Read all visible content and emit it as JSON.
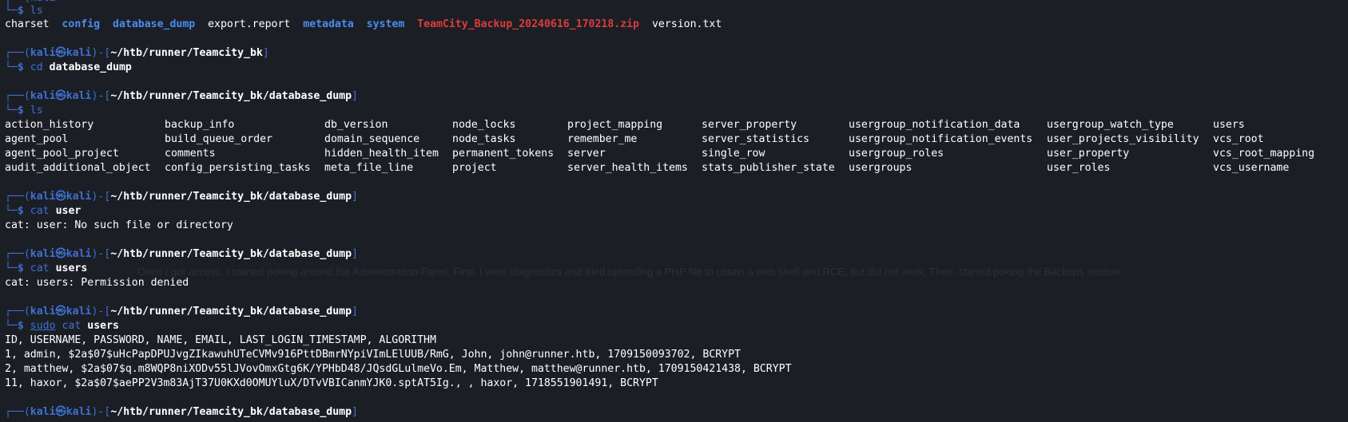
{
  "prompt": {
    "user": "kali",
    "at": "㉿",
    "host": "kali",
    "top": "┌──(",
    "close": ")-[",
    "end": "]",
    "bottom": "└─",
    "dollar": "$"
  },
  "paths": {
    "bk": "~/htb/runner/Teamcity_bk",
    "dump": "~/htb/runner/Teamcity_bk/database_dump"
  },
  "cmds": {
    "ls": "ls",
    "cd": "cd",
    "cd_arg": "database_dump",
    "cat": "cat",
    "sudo": "sudo",
    "arg_user": "user",
    "arg_users": "users"
  },
  "ls1": {
    "charset": "charset",
    "config": "config",
    "database_dump": "database_dump",
    "export_report": "export.report",
    "metadata": "metadata",
    "system": "system",
    "zip": "TeamCity_Backup_20240616_170218.zip",
    "version": "version.txt"
  },
  "ls2": [
    [
      "action_history",
      "agent_pool",
      "agent_pool_project",
      "audit_additional_object"
    ],
    [
      "backup_info",
      "build_queue_order",
      "comments",
      "config_persisting_tasks"
    ],
    [
      "db_version",
      "domain_sequence",
      "hidden_health_item",
      "meta_file_line"
    ],
    [
      "node_locks",
      "node_tasks",
      "permanent_tokens",
      "project"
    ],
    [
      "project_mapping",
      "remember_me",
      "server",
      "server_health_items"
    ],
    [
      "server_property",
      "server_statistics",
      "single_row",
      "stats_publisher_state"
    ],
    [
      "usergroup_notification_data",
      "usergroup_notification_events",
      "usergroup_roles",
      "usergroups"
    ],
    [
      "usergroup_watch_type",
      "user_projects_visibility",
      "user_property",
      "user_roles"
    ],
    [
      "users",
      "vcs_root",
      "vcs_root_mapping",
      "vcs_username"
    ]
  ],
  "errors": {
    "user": "cat: user: No such file or directory",
    "users": "cat: users: Permission denied"
  },
  "users_table": [
    "ID, USERNAME, PASSWORD, NAME, EMAIL, LAST_LOGIN_TIMESTAMP, ALGORITHM",
    "1, admin, $2a$07$uHcPapDPUJvgZIkawuhUTeCVMv916PttDBmrNYpiVImLElUUB/RmG, John, john@runner.htb, 1709150093702, BCRYPT",
    "2, matthew, $2a$07$q.m8WQP8niXODv55lJVovOmxGtg6K/YPHbD48/JQsdGLulmeVo.Em, Matthew, matthew@runner.htb, 1709150421438, BCRYPT",
    "11, haxor, $2a$07$aePP2V3m83AjT37U0KXd0OMUYluX/DTvVBICanmYJK0.sptAT5Ig., , haxor, 1718551901491, BCRYPT"
  ],
  "ghost_text": "Once I got access, I started poking around the Administration Panel. First, I went diagnostics and tried uploading a PHP file to obtain a web shell and RCE, but did not work. Then, started poking the Backups section.",
  "colors": {
    "background": "#1b1f25",
    "prompt_blue": "#3f6fd0",
    "dir_blue": "#4a8cf0",
    "archive_red": "#e03a3a",
    "text": "#ffffff"
  }
}
